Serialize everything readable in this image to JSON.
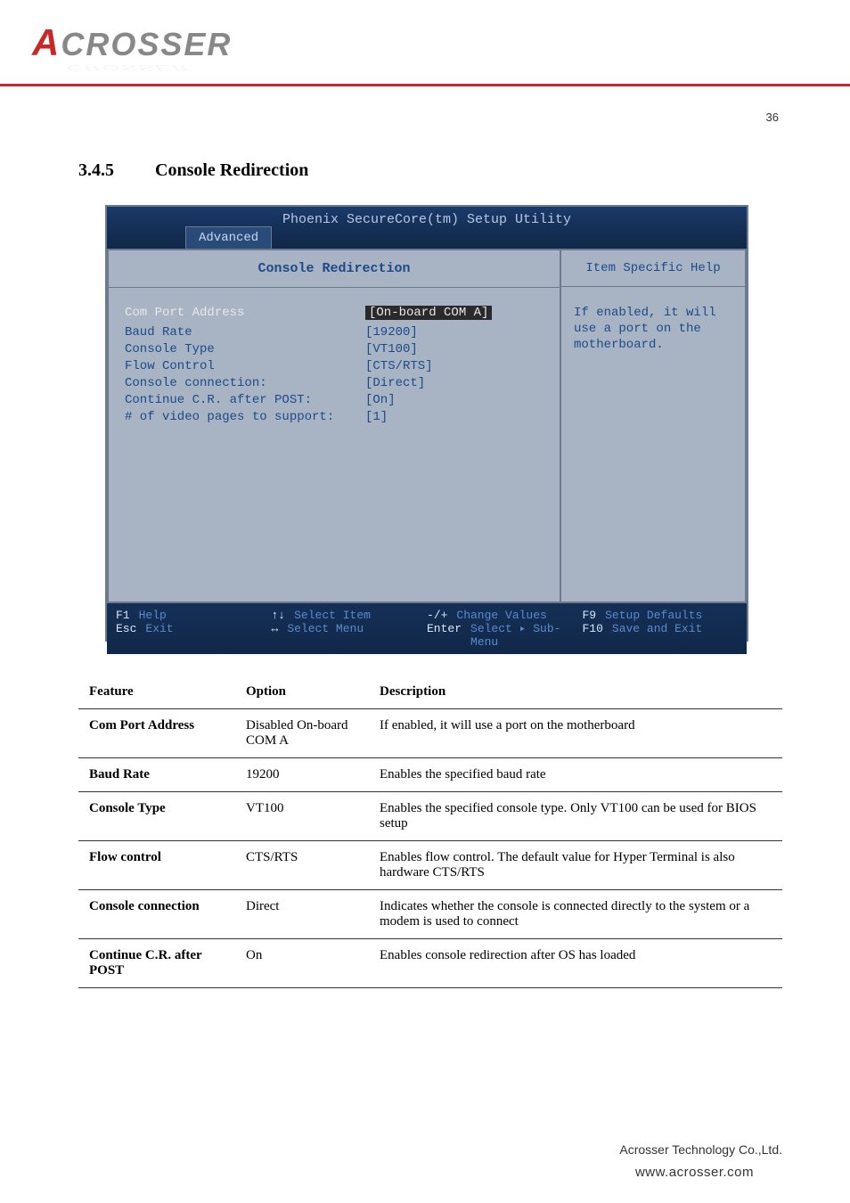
{
  "header": {
    "logo_a": "A",
    "logo_rest": "CROSSER",
    "page_number": "36"
  },
  "section": {
    "number": "3.4.5",
    "title": "Console Redirection"
  },
  "bios": {
    "title": "Phoenix SecureCore(tm) Setup Utility",
    "tab": "Advanced",
    "section_title": "Console Redirection",
    "help_title": "Item Specific Help",
    "help_text": "If enabled, it will use a port on the motherboard.",
    "items": [
      {
        "label": "Com Port Address",
        "value": "[On-board COM A]",
        "label_white": true,
        "val_highlight": true
      },
      {
        "label": "",
        "value": ""
      },
      {
        "label": "Baud Rate",
        "value": "[19200]"
      },
      {
        "label": "Console Type",
        "value": "[VT100]"
      },
      {
        "label": "Flow Control",
        "value": "[CTS/RTS]"
      },
      {
        "label": "Console connection:",
        "value": "[Direct]"
      },
      {
        "label": "Continue C.R. after POST:",
        "value": "[On]"
      },
      {
        "label": "# of video pages to support:",
        "value": "[1]"
      }
    ],
    "footer": [
      {
        "key": "F1",
        "action": "Help"
      },
      {
        "key": "↑↓",
        "action": "Select Item"
      },
      {
        "key": "-/+",
        "action": "Change Values"
      },
      {
        "key": "F9",
        "action": "Setup Defaults"
      },
      {
        "key": "Esc",
        "action": "Exit"
      },
      {
        "key": "↔",
        "action": "Select Menu"
      },
      {
        "key": "Enter",
        "action": "Select ▸ Sub-Menu"
      },
      {
        "key": "F10",
        "action": "Save and Exit"
      }
    ]
  },
  "table": {
    "headers": [
      "Feature",
      "Option",
      "Description"
    ],
    "rows": [
      {
        "feature": "Com Port Address",
        "option": "Disabled On-board COM A",
        "description": "If enabled, it will use a port on the motherboard"
      },
      {
        "feature": "Baud Rate",
        "option": "19200",
        "description": "Enables the specified baud rate"
      },
      {
        "feature": "Console Type",
        "option": "VT100",
        "description": "Enables the specified console type. Only VT100 can be used for BIOS setup"
      },
      {
        "feature": "Flow control",
        "option": "CTS/RTS",
        "description": "Enables flow control. The default value for Hyper Terminal is also hardware CTS/RTS"
      },
      {
        "feature": "Console connection",
        "option": "Direct",
        "description": "Indicates whether the console is connected directly to the system or a modem is used to connect"
      },
      {
        "feature": "Continue C.R. after POST",
        "option": "On",
        "description": "Enables console redirection after OS has loaded"
      }
    ]
  },
  "footer": {
    "company": "Acrosser Technology Co.,Ltd.",
    "url": "www.acrosser.com"
  }
}
